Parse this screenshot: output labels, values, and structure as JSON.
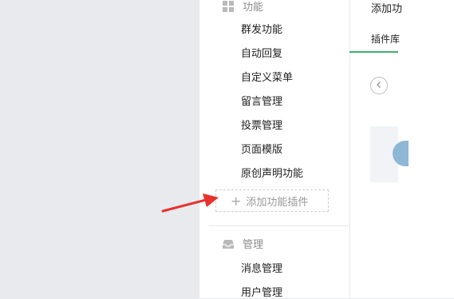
{
  "sidebar": {
    "function_section": {
      "title": "功能",
      "icon": "grid-icon"
    },
    "function_items": [
      {
        "label": "群发功能"
      },
      {
        "label": "自动回复"
      },
      {
        "label": "自定义菜单"
      },
      {
        "label": "留言管理"
      },
      {
        "label": "投票管理"
      },
      {
        "label": "页面模版"
      },
      {
        "label": "原创声明功能"
      }
    ],
    "add_plugin": {
      "label": "添加功能插件",
      "icon": "plus-icon"
    },
    "manage_section": {
      "title": "管理",
      "icon": "inbox-icon"
    },
    "manage_items": [
      {
        "label": "消息管理"
      },
      {
        "label": "用户管理"
      }
    ]
  },
  "main": {
    "header_title": "添加功",
    "tab_label": "插件库",
    "back_icon": "chevron-left-icon"
  },
  "colors": {
    "accent_green": "#3eb26b",
    "annotation_arrow": "#e8322c"
  }
}
